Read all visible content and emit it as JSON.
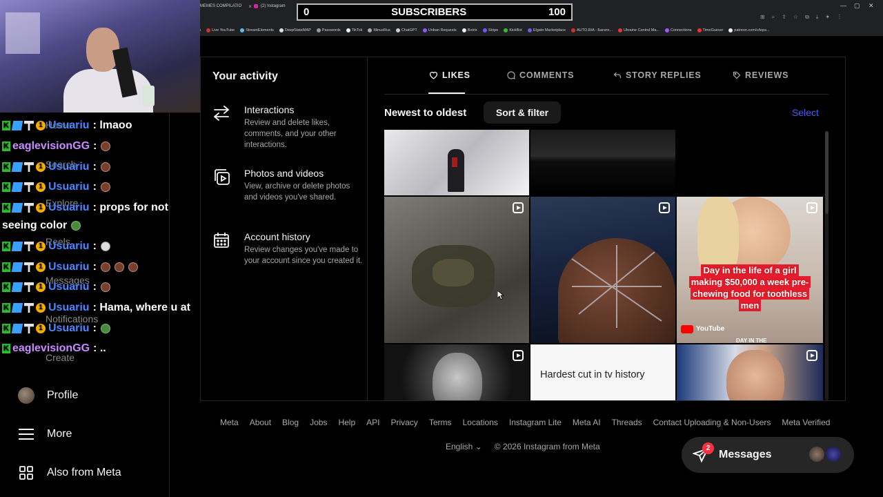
{
  "browser": {
    "tabs": [
      {
        "label": "MEMES COMPILATIO",
        "close": "×"
      },
      {
        "label": "(2) Instagram",
        "close": "×"
      }
    ],
    "new_tab": "+",
    "window_controls": [
      "—",
      "▢",
      "✕"
    ],
    "bookmarks": [
      "Live YouTube",
      "StreamElements",
      "DeepStateMAP",
      "Passwords",
      "TikTok",
      "MinusRus",
      "ChatGPT",
      "Unban Requests",
      "Botrix",
      "Stripe",
      "KickBot",
      "Elgato Marketplace",
      "AUTO.RIA - Багато...",
      "Ukraine Control Ma...",
      "Connections",
      "TimeGuessr",
      "patreon.com/c/tops..."
    ]
  },
  "overlay": {
    "sub_current": "0",
    "sub_label": "SUBSCRIBERS",
    "sub_goal": "100"
  },
  "chat": [
    {
      "user": "Usuariu",
      "text": ": lmaoo",
      "badges": true,
      "color": "blue",
      "emotes": 0
    },
    {
      "user": "eaglevisionGG",
      "text": ":",
      "badges": false,
      "color": "purple",
      "emotes": 1
    },
    {
      "user": "Usuariu",
      "text": ":",
      "badges": true,
      "color": "blue",
      "emotes": 1
    },
    {
      "user": "Usuariu",
      "text": ":",
      "badges": true,
      "color": "blue",
      "emotes": 1
    },
    {
      "user": "Usuariu",
      "text": ": props for not",
      "badges": true,
      "color": "blue",
      "emotes": 0
    },
    {
      "user": "",
      "text": "seeing color",
      "badges": false,
      "color": "white",
      "emotes": 1
    },
    {
      "user": "Usuariu",
      "text": ":",
      "badges": true,
      "color": "blue",
      "emotes": 1
    },
    {
      "user": "Usuariu",
      "text": ":",
      "badges": true,
      "color": "blue",
      "emotes": 3
    },
    {
      "user": "Usuariu",
      "text": ":",
      "badges": true,
      "color": "blue",
      "emotes": 1
    },
    {
      "user": "Usuariu",
      "text": ": Hama, where u at",
      "badges": true,
      "color": "blue",
      "emotes": 0
    },
    {
      "user": "Usuariu",
      "text": ":",
      "badges": true,
      "color": "blue",
      "emotes": 1
    },
    {
      "user": "eaglevisionGG",
      "text": ": ..",
      "badges": false,
      "color": "purple",
      "emotes": 0
    }
  ],
  "nav": {
    "home": "Home",
    "search": "Search",
    "explore": "Explore",
    "reels": "Reels",
    "messages": "Messages",
    "notifications": "Notifications",
    "create": "Create",
    "profile": "Profile",
    "more": "More",
    "also_from_meta": "Also from Meta"
  },
  "activity": {
    "title": "Your activity",
    "items": [
      {
        "title": "Interactions",
        "desc": "Review and delete likes, comments, and your other interactions."
      },
      {
        "title": "Photos and videos",
        "desc": "View, archive or delete photos and videos you've shared."
      },
      {
        "title": "Account history",
        "desc": "Review changes you've made to your account since you created it."
      }
    ]
  },
  "tabs": {
    "likes": "LIKES",
    "comments": "COMMENTS",
    "story_replies": "STORY REPLIES",
    "reviews": "REVIEWS"
  },
  "sort": {
    "label": "Newest to oldest",
    "button": "Sort & filter",
    "select": "Select"
  },
  "tiles": {
    "girl_caption": "Day in the life of a girl making $50,000 a week pre-chewing food for toothless men",
    "girl_yt": "YouTube",
    "girl_dayin": "DAY IN THE",
    "cut_text": "Hardest cut in tv history"
  },
  "footer": {
    "links": [
      "Meta",
      "About",
      "Blog",
      "Jobs",
      "Help",
      "API",
      "Privacy",
      "Terms",
      "Locations",
      "Instagram Lite",
      "Meta AI",
      "Threads",
      "Contact Uploading & Non-Users",
      "Meta Verified"
    ],
    "language": "English",
    "copyright": "© 2026 Instagram from Meta"
  },
  "messages_pill": {
    "label": "Messages",
    "badge": "2"
  },
  "colors": {
    "accent_link": "#4a5df9",
    "badge_red": "#ff3040",
    "chat_blue": "#4a86ff",
    "chat_purple": "#c98cff"
  }
}
